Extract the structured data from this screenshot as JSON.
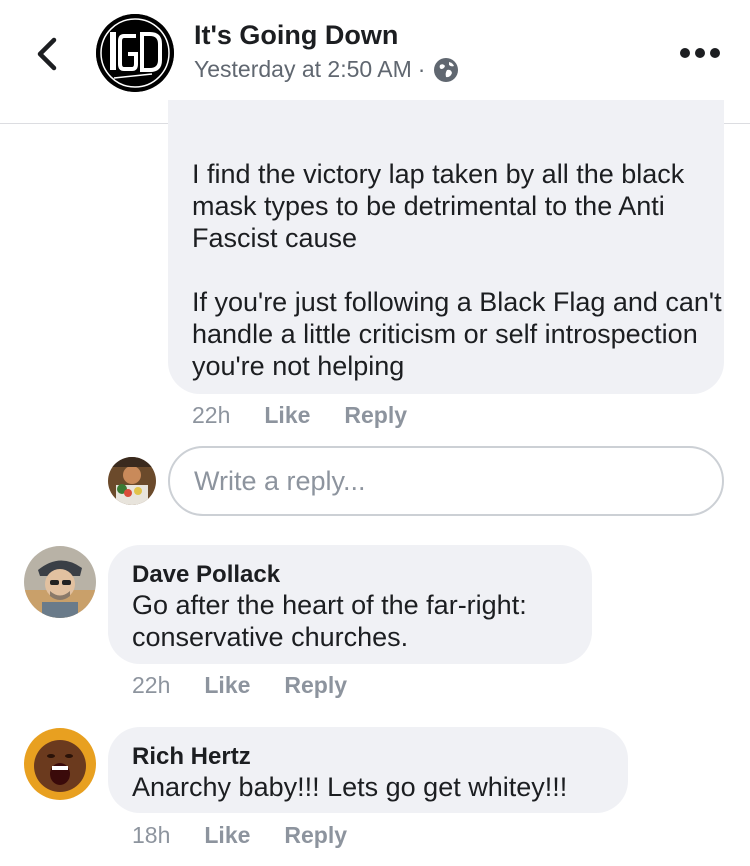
{
  "header": {
    "page_name": "It's Going Down",
    "timestamp": "Yesterday at 2:50 AM",
    "separator": "·",
    "avatar_logo_text": "IGD",
    "privacy_icon": "globe-icon",
    "back_icon": "chevron-left-icon",
    "more_icon": "more-dots-icon"
  },
  "comments": [
    {
      "paragraphs": [
        "I find the victory lap taken by all the black mask types to be detrimental to the Anti Fascist cause",
        "If you're just following a Black Flag and can't handle a little criticism or self introspection you're not helping"
      ],
      "time": "22h",
      "like": "Like",
      "reply": "Reply"
    },
    {
      "author": "Dave Pollack",
      "text": "Go after the heart of the far-right: conservative churches.",
      "time": "22h",
      "like": "Like",
      "reply": "Reply"
    },
    {
      "author": "Rich Hertz",
      "text": "Anarchy baby!!! Lets go get whitey!!!",
      "time": "18h",
      "like": "Like",
      "reply": "Reply"
    }
  ],
  "reply_box": {
    "placeholder": "Write a reply..."
  },
  "colors": {
    "bubble": "#f0f1f5",
    "meta_text": "#8d949e",
    "primary_text": "#1c1e21",
    "secondary_text": "#606770"
  }
}
